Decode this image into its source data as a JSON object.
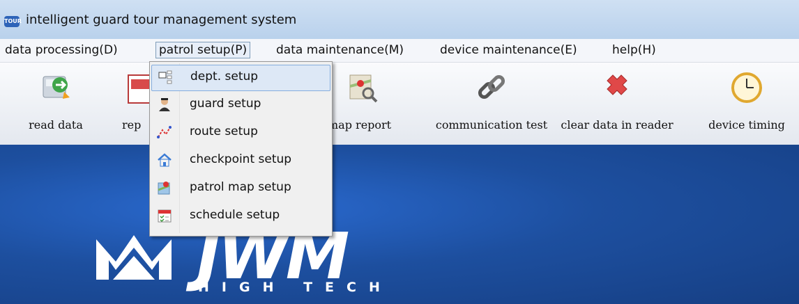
{
  "window": {
    "title": "intelligent guard tour management system",
    "app_icon_text": "TOUR"
  },
  "menubar": {
    "items": [
      {
        "label": "data processing(D)"
      },
      {
        "label": "patrol setup(P)"
      },
      {
        "label": "data maintenance(M)"
      },
      {
        "label": "device maintenance(E)"
      },
      {
        "label": "help(H)"
      }
    ]
  },
  "toolbar": {
    "buttons": [
      {
        "label": "read data",
        "icon": "read-data-icon"
      },
      {
        "label": "rep",
        "icon": "report-icon"
      },
      {
        "label": "map report",
        "icon": "map-report-icon"
      },
      {
        "label": "communication test",
        "icon": "link-icon"
      },
      {
        "label": "clear data in reader",
        "icon": "clear-x-icon"
      },
      {
        "label": "device timing",
        "icon": "clock-icon"
      }
    ]
  },
  "dropdown": {
    "items": [
      {
        "label": "dept. setup",
        "icon": "dept-icon"
      },
      {
        "label": "guard setup",
        "icon": "guard-icon"
      },
      {
        "label": "route setup",
        "icon": "route-icon"
      },
      {
        "label": "checkpoint setup",
        "icon": "house-icon"
      },
      {
        "label": "patrol map setup",
        "icon": "map-pin-icon"
      },
      {
        "label": "schedule setup",
        "icon": "calendar-icon"
      }
    ]
  },
  "logo": {
    "main": "JWM",
    "sub": "HIGH TECH"
  },
  "colors": {
    "background": "#1f4fa0",
    "menu_highlight": "#dde8f6",
    "clear_icon": "#e04848"
  }
}
